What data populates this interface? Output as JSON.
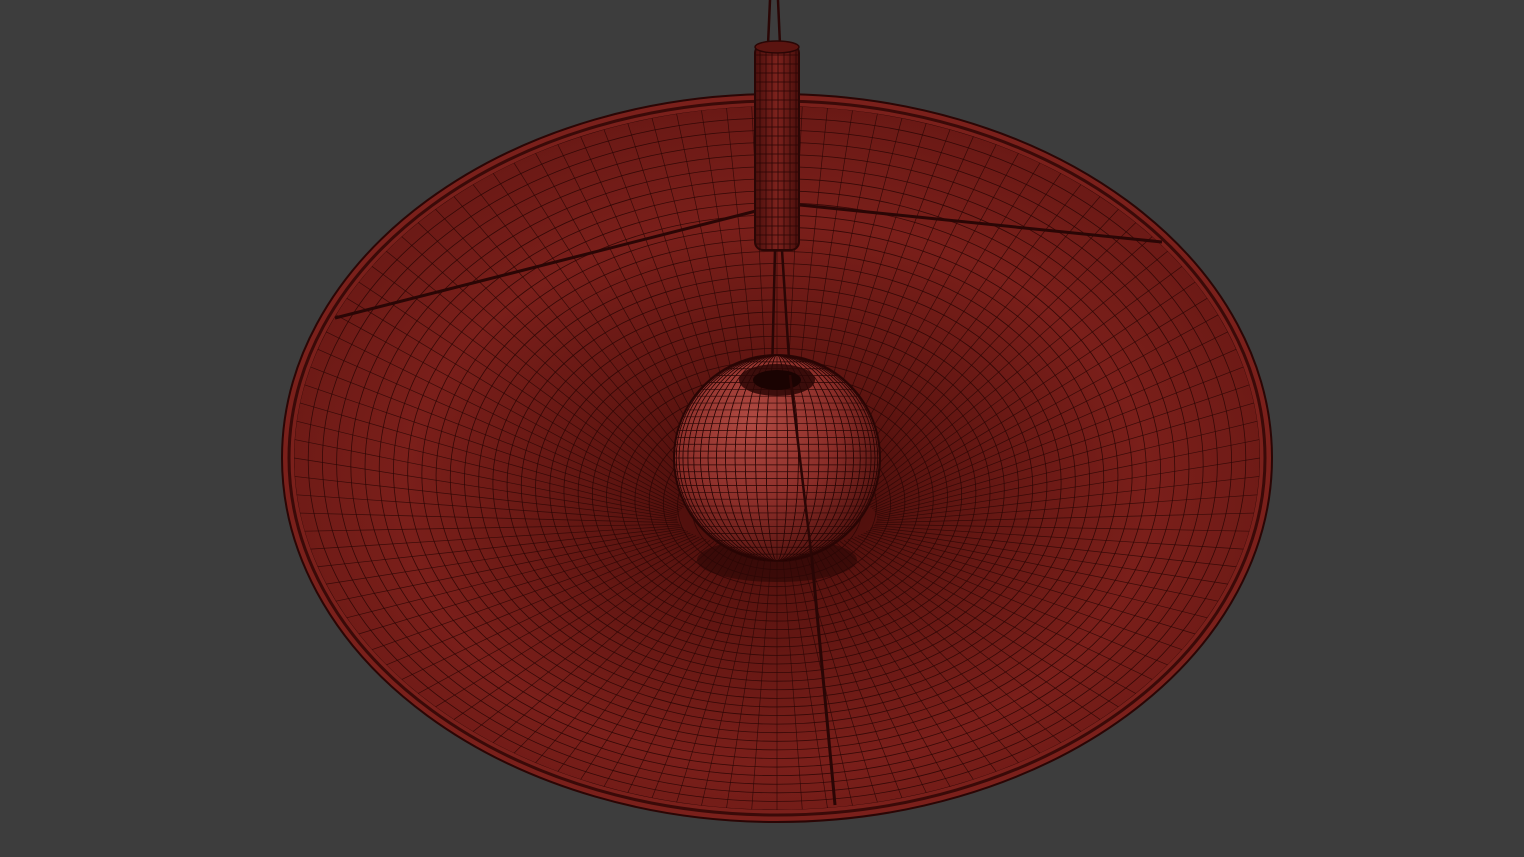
{
  "scene": {
    "subject": "pendant-lamp-wireframe",
    "colors": {
      "background": "#3d3d3d",
      "shade_fill": "#6e1a16",
      "shade_dark": "#4a0f0c",
      "wire": "#2a0605",
      "sphere_fill": "#8a2d28",
      "sphere_highlight": "#a8443d",
      "rod_fill": "#6a1814"
    }
  }
}
